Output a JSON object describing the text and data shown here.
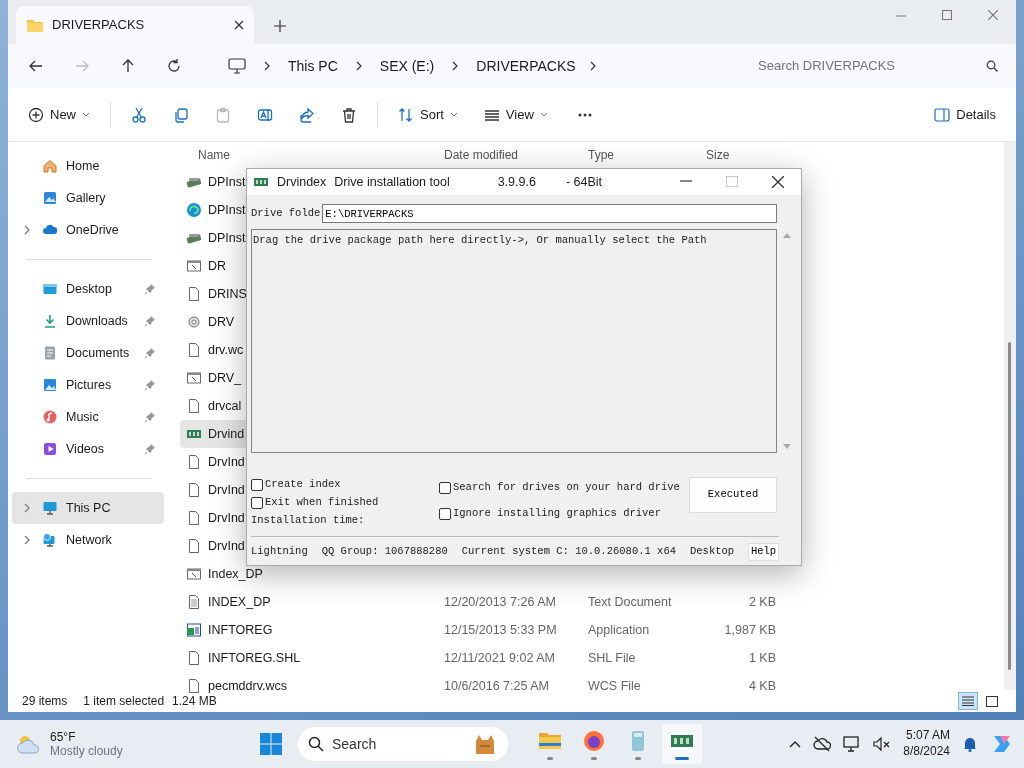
{
  "tab": {
    "title": "DRIVERPACKS"
  },
  "breadcrumb": [
    "This PC",
    "SEX (E:)",
    "DRIVERPACKS"
  ],
  "search": {
    "placeholder": "Search DRIVERPACKS"
  },
  "toolbar": [
    {
      "kind": "new",
      "label": "New",
      "disabled": false
    },
    {
      "kind": "cut",
      "disabled": false
    },
    {
      "kind": "copy",
      "disabled": false
    },
    {
      "kind": "paste",
      "disabled": true
    },
    {
      "kind": "rename",
      "disabled": false
    },
    {
      "kind": "share",
      "disabled": false
    },
    {
      "kind": "delete",
      "disabled": false
    },
    {
      "kind": "sort",
      "label": "Sort",
      "disabled": false
    },
    {
      "kind": "view",
      "label": "View",
      "disabled": false
    },
    {
      "kind": "more",
      "disabled": false
    }
  ],
  "details_button": "Details",
  "sidebar": [
    [
      {
        "label": "Home",
        "kind": "home",
        "pinned": false,
        "expandable": false,
        "selected": false
      },
      {
        "label": "Gallery",
        "kind": "gallery",
        "pinned": false,
        "expandable": false,
        "selected": false
      },
      {
        "label": "OneDrive",
        "kind": "cloud",
        "pinned": false,
        "expandable": true,
        "selected": false
      }
    ],
    [
      {
        "label": "Desktop",
        "kind": "desktop",
        "pinned": true,
        "expandable": false,
        "selected": false
      },
      {
        "label": "Downloads",
        "kind": "download",
        "pinned": true,
        "expandable": false,
        "selected": false
      },
      {
        "label": "Documents",
        "kind": "documents",
        "pinned": true,
        "expandable": false,
        "selected": false
      },
      {
        "label": "Pictures",
        "kind": "pictures",
        "pinned": true,
        "expandable": false,
        "selected": false
      },
      {
        "label": "Music",
        "kind": "music",
        "pinned": true,
        "expandable": false,
        "selected": false
      },
      {
        "label": "Videos",
        "kind": "videos",
        "pinned": true,
        "expandable": false,
        "selected": false
      }
    ],
    [
      {
        "label": "This PC",
        "kind": "pc",
        "pinned": false,
        "expandable": true,
        "selected": true
      },
      {
        "label": "Network",
        "kind": "network",
        "pinned": false,
        "expandable": true,
        "selected": false
      }
    ]
  ],
  "columns": [
    "Name",
    "Date modified",
    "Type",
    "Size"
  ],
  "files": [
    {
      "name": "DPInst",
      "kind": "setup",
      "selected": false
    },
    {
      "name": "DPInst",
      "kind": "edge",
      "selected": false
    },
    {
      "name": "DPInst",
      "kind": "setup",
      "selected": false
    },
    {
      "name": "DR",
      "kind": "shortcut",
      "selected": false
    },
    {
      "name": "DRINS",
      "kind": "blank",
      "selected": false
    },
    {
      "name": "DRV",
      "kind": "gear",
      "selected": false
    },
    {
      "name": "drv.wc",
      "kind": "blank",
      "selected": false
    },
    {
      "name": "DRV_",
      "kind": "shortcut",
      "selected": false
    },
    {
      "name": "drvcal",
      "kind": "blank",
      "selected": false
    },
    {
      "name": "Drvind",
      "kind": "card",
      "selected": true
    },
    {
      "name": "DrvInd",
      "kind": "blank",
      "selected": false
    },
    {
      "name": "DrvInd",
      "kind": "blank",
      "selected": false
    },
    {
      "name": "DrvInd",
      "kind": "blank",
      "selected": false
    },
    {
      "name": "DrvInd",
      "kind": "blank",
      "selected": false
    },
    {
      "name": "Index_DP",
      "kind": "shortcut",
      "selected": false
    },
    {
      "name": "INDEX_DP",
      "kind": "text",
      "selected": false,
      "date": "12/20/2013 7:26 AM",
      "type": "Text Document",
      "size": "2 KB"
    },
    {
      "name": "INFTOREG",
      "kind": "app",
      "selected": false,
      "date": "12/15/2013 5:33 PM",
      "type": "Application",
      "size": "1,987 KB"
    },
    {
      "name": "INFTOREG.SHL",
      "kind": "blank",
      "selected": false,
      "date": "12/11/2021 9:02 AM",
      "type": "SHL File",
      "size": "1 KB"
    },
    {
      "name": "pecmddrv.wcs",
      "kind": "blank",
      "selected": false,
      "date": "10/6/2016 7:25 AM",
      "type": "WCS File",
      "size": "4 KB"
    }
  ],
  "status_bar": {
    "count": "29 items",
    "selection": "1 item selected",
    "size": "1.24 MB"
  },
  "dialog": {
    "title": "Drvindex",
    "subtitle": "Drive installation tool",
    "version": "3.9.9.6",
    "arch": "- 64Bit",
    "folder_label": "Drive folde",
    "folder_value": "E:\\DRIVERPACKS",
    "log": "Drag the drive package path here directly->, Or manually select the Path",
    "options": [
      {
        "label": "Create index",
        "checked": false
      },
      {
        "label": "Exit when finished",
        "checked": false
      },
      {
        "label": "Search for drives on your hard drive",
        "checked": false
      },
      {
        "label": "Ignore installing graphics driver",
        "checked": false
      }
    ],
    "install_time": "Installation time:",
    "execute_button": "Executed",
    "status": [
      "Lightning",
      "QQ Group: 1067888280",
      "Current system C: 10.0.26080.1 x64",
      "Desktop"
    ],
    "help_button": "Help"
  },
  "taskbar": {
    "weather": {
      "temp": "65°F",
      "desc": "Mostly cloudy"
    },
    "search": "Search",
    "apps": [
      {
        "kind": "folder",
        "active": false
      },
      {
        "kind": "firefox",
        "active": false
      },
      {
        "kind": "notepad",
        "active": false
      },
      {
        "kind": "card",
        "active": true
      }
    ],
    "time": "5:07 AM",
    "date": "8/8/2024"
  }
}
